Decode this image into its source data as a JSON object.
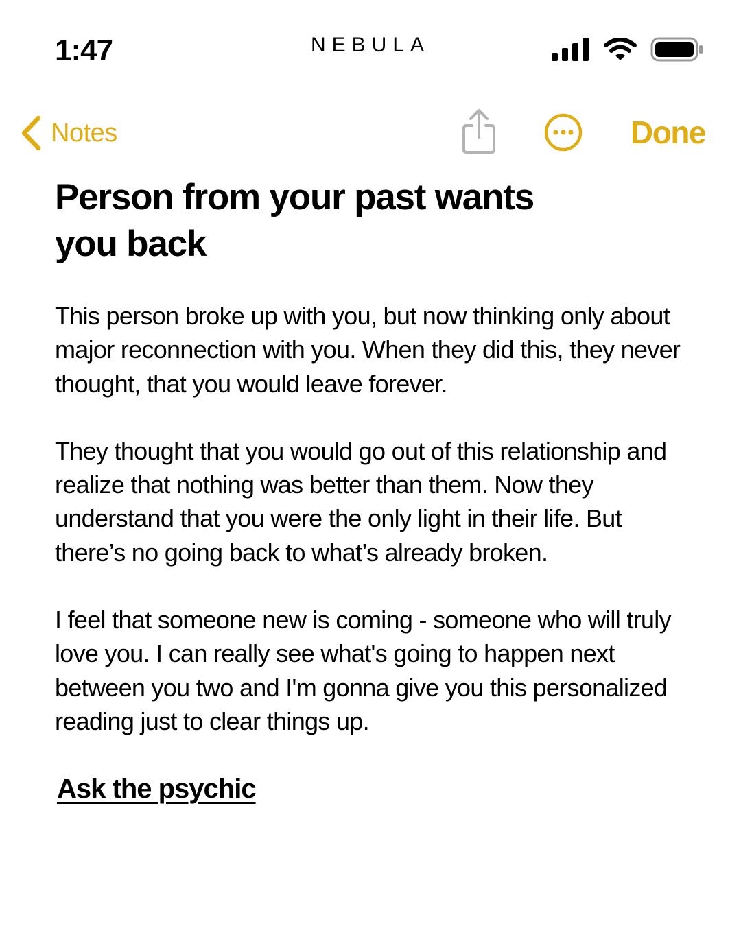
{
  "status_bar": {
    "time": "1:47",
    "brand": "NEBULA",
    "icons": [
      "signal-icon",
      "wifi-icon",
      "battery-icon"
    ]
  },
  "nav": {
    "back_label": "Notes",
    "share_icon": "share-icon",
    "more_icon": "more-icon",
    "done_label": "Done",
    "accent_color": "#e0ad14",
    "inactive_icon_color": "#b3b3b3"
  },
  "note": {
    "title": "Person from your past wants you back",
    "paragraphs": [
      "This person broke up with you, but now thinking only about major reconnection with you. When they did this, they never thought, that you would leave forever.",
      "They thought that you would go out of this relationship and realize that nothing was better than them. Now they understand that you were the only light in their life. But there’s no going back to what’s already broken.",
      "I feel that someone new is coming - someone who will truly love you. I can really see what's going to happen next between you two and I'm gonna give you this personalized reading just to clear things up."
    ],
    "link_label": "Ask the psychic"
  }
}
